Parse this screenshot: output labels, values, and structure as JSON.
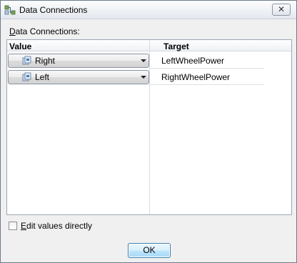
{
  "window": {
    "title": "Data Connections",
    "close_glyph": "✕",
    "app_icon": "data-connections-icon"
  },
  "section": {
    "label_mnemonic": "D",
    "label_rest": "ata Connections:"
  },
  "grid": {
    "columns": {
      "value": "Value",
      "target": "Target"
    },
    "rows": [
      {
        "value": "Right",
        "target": "LeftWheelPower",
        "icon": "data-source-icon"
      },
      {
        "value": "Left",
        "target": "RightWheelPower",
        "icon": "data-source-icon"
      }
    ]
  },
  "edit_directly": {
    "label_mnemonic": "E",
    "label_rest": "dit values directly",
    "checked": false
  },
  "buttons": {
    "ok": "OK"
  }
}
